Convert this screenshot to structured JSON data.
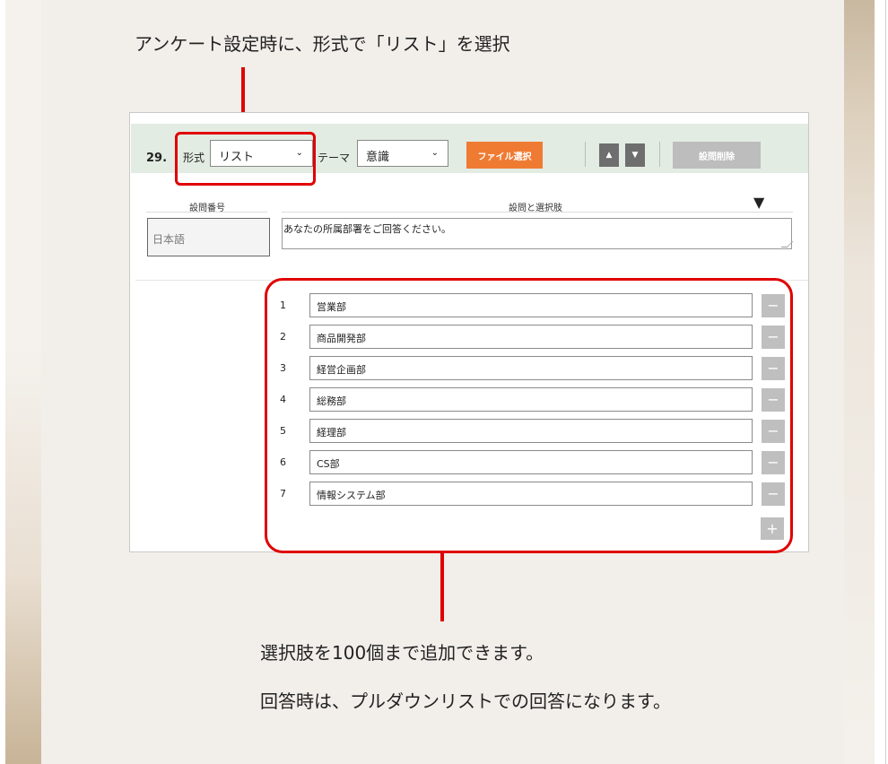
{
  "captions": {
    "top": "アンケート設定時に、形式で「リスト」を選択",
    "bottom_line1": "選択肢を100個まで追加できます。",
    "bottom_line2": "回答時は、プルダウンリストでの回答になります。"
  },
  "toolbar": {
    "question_number": "29.",
    "format_label": "形式",
    "format_value": "リスト",
    "theme_label": "テーマ",
    "theme_value": "意識",
    "file_button": "ファイル選択",
    "up_icon": "▲",
    "down_icon": "▼",
    "delete_button": "設問削除"
  },
  "headers": {
    "number": "設問番号",
    "choices": "設問と選択肢",
    "collapse_icon": "▼"
  },
  "question": {
    "language": "日本語",
    "text": "あなたの所属部署をご回答ください。"
  },
  "choices": [
    {
      "num": "1",
      "value": "営業部"
    },
    {
      "num": "2",
      "value": "商品開発部"
    },
    {
      "num": "3",
      "value": "経営企画部"
    },
    {
      "num": "4",
      "value": "総務部"
    },
    {
      "num": "5",
      "value": "経理部"
    },
    {
      "num": "6",
      "value": "CS部"
    },
    {
      "num": "7",
      "value": "情報システム部"
    }
  ],
  "controls": {
    "remove_symbol": "−",
    "add_symbol": "+"
  },
  "colors": {
    "highlight": "#e00000",
    "file_button": "#ef7b33",
    "toolbar_bg": "#e3ece3",
    "page_bg": "#f2efea"
  }
}
